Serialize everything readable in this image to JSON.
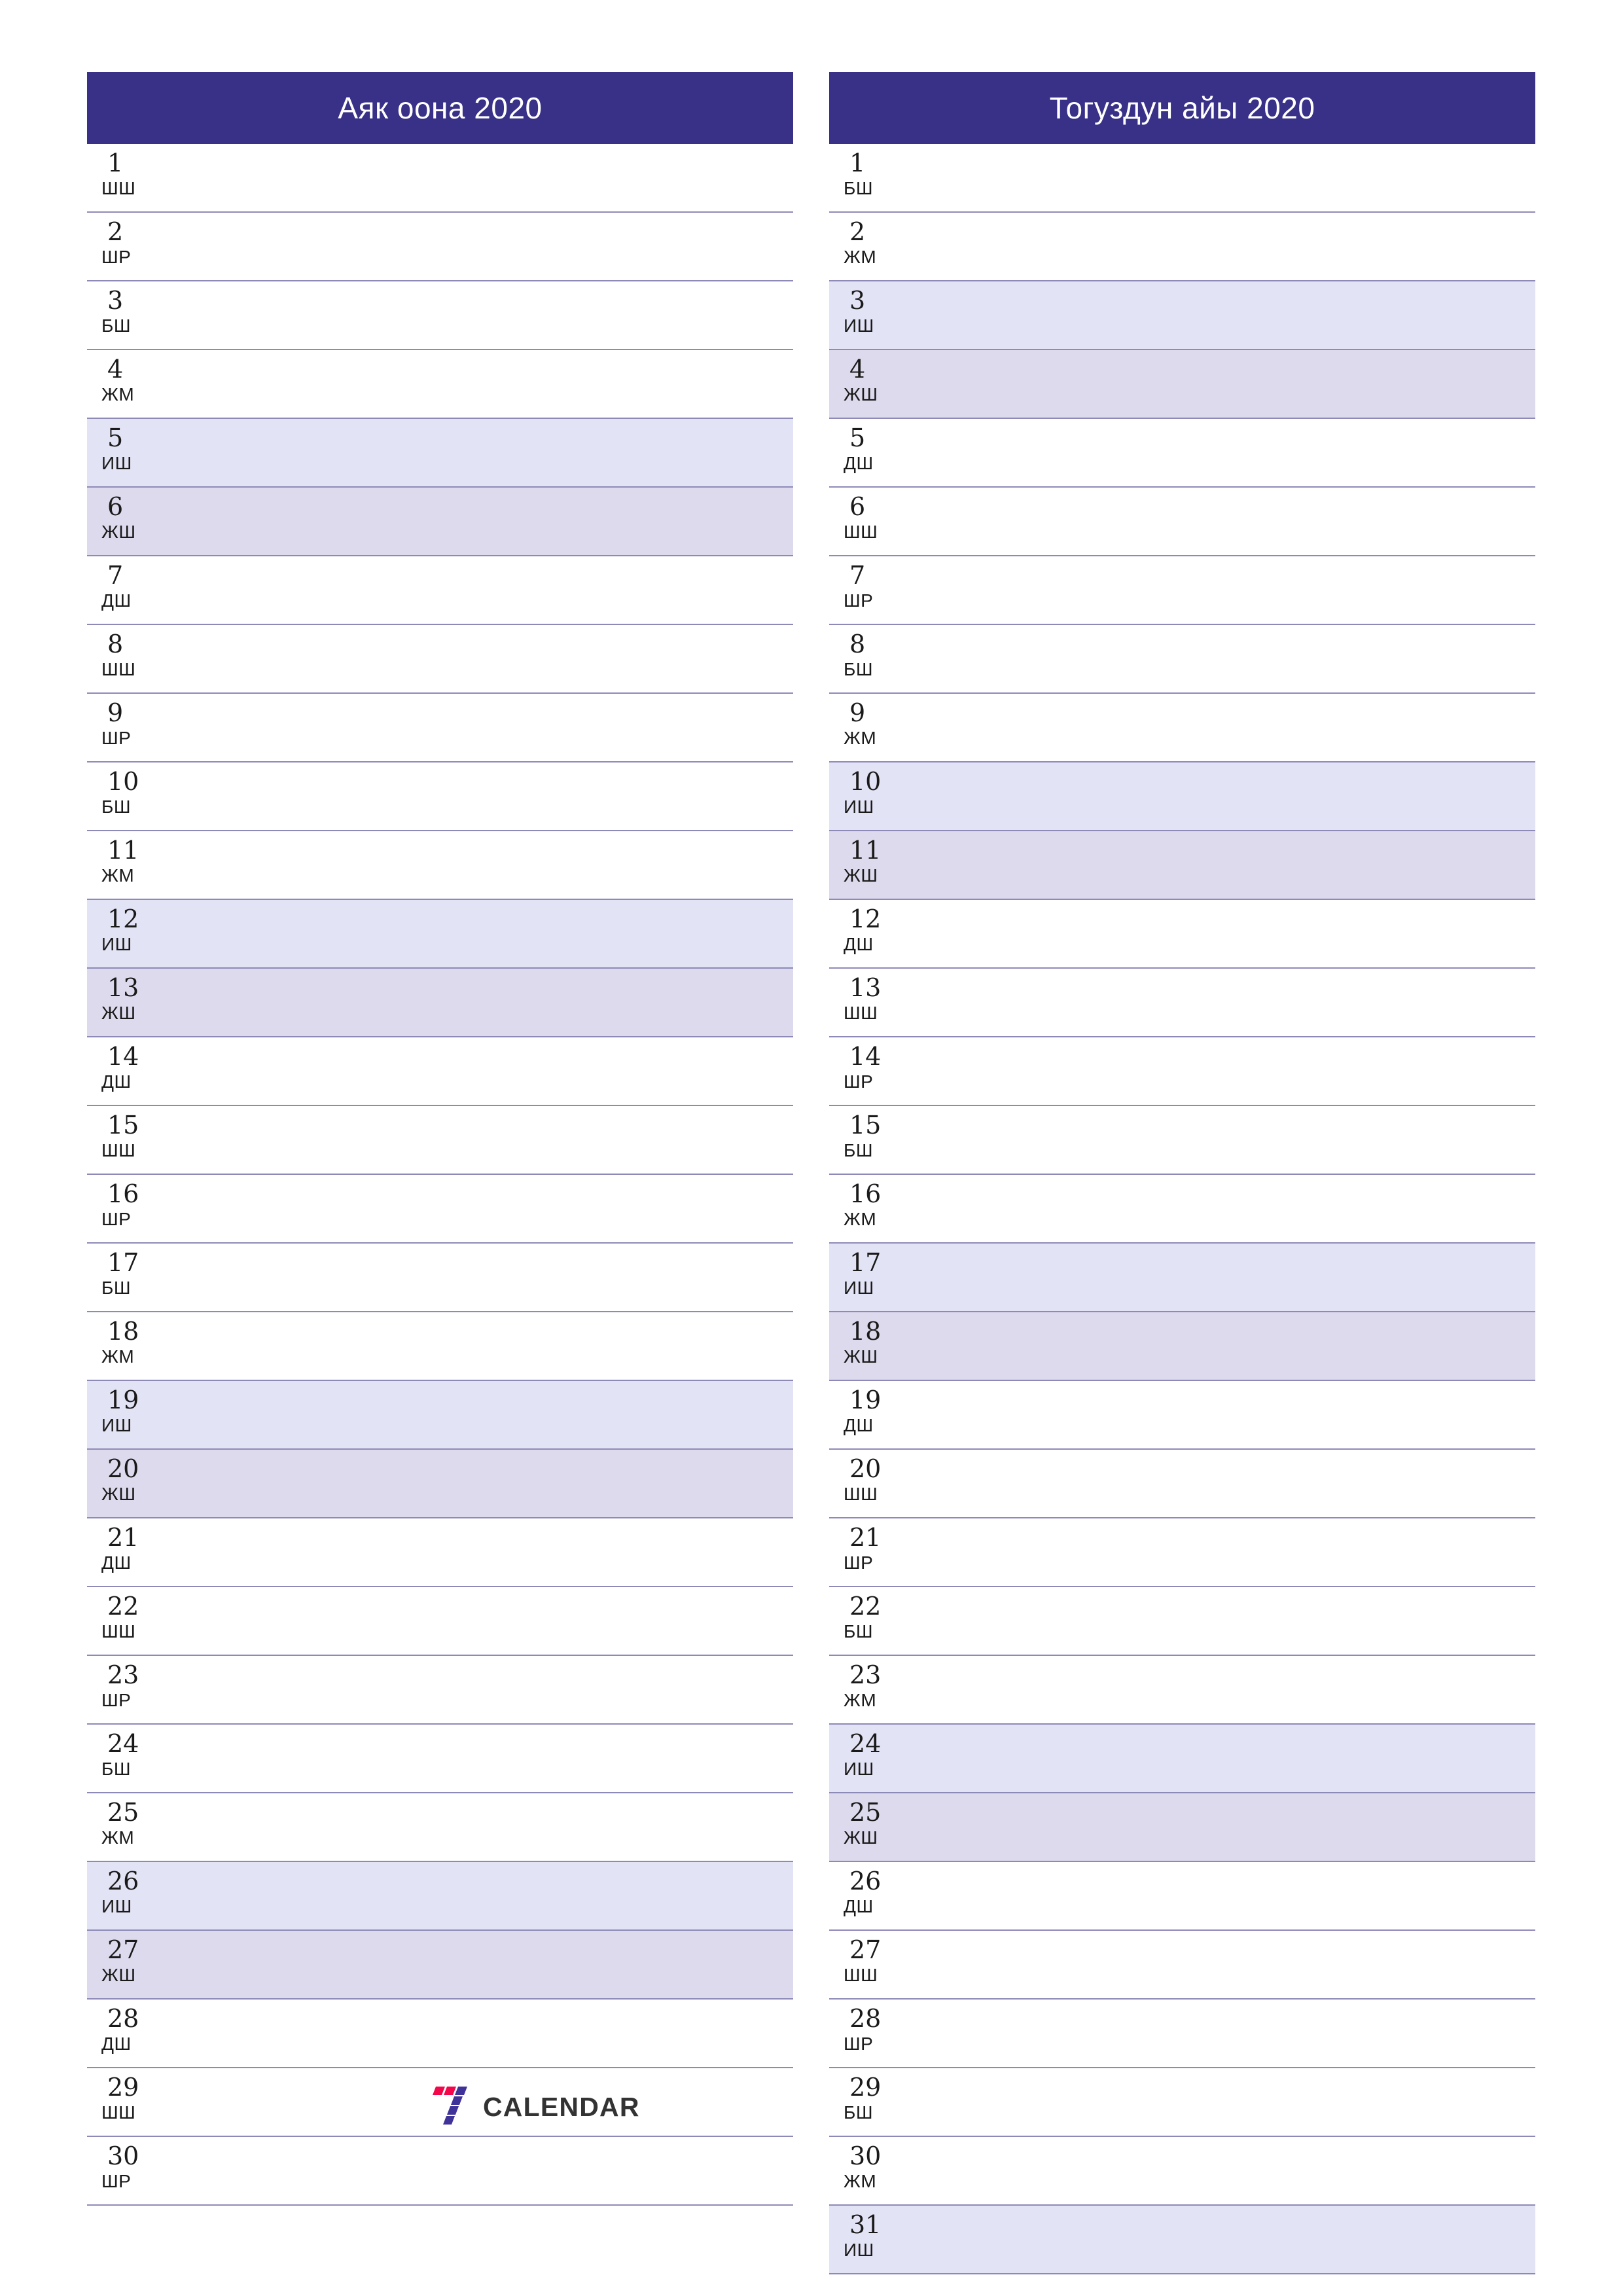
{
  "page": {
    "background_color": "#ffffff",
    "accent_color": "#383187",
    "grid_line_color": "#8e8ab8",
    "saturday_color": "#e3e3f6",
    "sunday_color": "#dddaed"
  },
  "brand": {
    "name": "CALENDAR",
    "mark_icon": "seven-logo-icon",
    "mark_colors": {
      "red": "#f4064a",
      "purple": "#3f3399"
    }
  },
  "months": [
    {
      "title": "Аяк оона 2020",
      "days": [
        {
          "num": "1",
          "abbr": "ШШ",
          "type": "weekday"
        },
        {
          "num": "2",
          "abbr": "ШР",
          "type": "weekday"
        },
        {
          "num": "3",
          "abbr": "БШ",
          "type": "weekday"
        },
        {
          "num": "4",
          "abbr": "ЖМ",
          "type": "weekday"
        },
        {
          "num": "5",
          "abbr": "ИШ",
          "type": "saturday"
        },
        {
          "num": "6",
          "abbr": "ЖШ",
          "type": "sunday"
        },
        {
          "num": "7",
          "abbr": "ДШ",
          "type": "weekday"
        },
        {
          "num": "8",
          "abbr": "ШШ",
          "type": "weekday"
        },
        {
          "num": "9",
          "abbr": "ШР",
          "type": "weekday"
        },
        {
          "num": "10",
          "abbr": "БШ",
          "type": "weekday"
        },
        {
          "num": "11",
          "abbr": "ЖМ",
          "type": "weekday"
        },
        {
          "num": "12",
          "abbr": "ИШ",
          "type": "saturday"
        },
        {
          "num": "13",
          "abbr": "ЖШ",
          "type": "sunday"
        },
        {
          "num": "14",
          "abbr": "ДШ",
          "type": "weekday"
        },
        {
          "num": "15",
          "abbr": "ШШ",
          "type": "weekday"
        },
        {
          "num": "16",
          "abbr": "ШР",
          "type": "weekday"
        },
        {
          "num": "17",
          "abbr": "БШ",
          "type": "weekday"
        },
        {
          "num": "18",
          "abbr": "ЖМ",
          "type": "weekday"
        },
        {
          "num": "19",
          "abbr": "ИШ",
          "type": "saturday"
        },
        {
          "num": "20",
          "abbr": "ЖШ",
          "type": "sunday"
        },
        {
          "num": "21",
          "abbr": "ДШ",
          "type": "weekday"
        },
        {
          "num": "22",
          "abbr": "ШШ",
          "type": "weekday"
        },
        {
          "num": "23",
          "abbr": "ШР",
          "type": "weekday"
        },
        {
          "num": "24",
          "abbr": "БШ",
          "type": "weekday"
        },
        {
          "num": "25",
          "abbr": "ЖМ",
          "type": "weekday"
        },
        {
          "num": "26",
          "abbr": "ИШ",
          "type": "saturday"
        },
        {
          "num": "27",
          "abbr": "ЖШ",
          "type": "sunday"
        },
        {
          "num": "28",
          "abbr": "ДШ",
          "type": "weekday"
        },
        {
          "num": "29",
          "abbr": "ШШ",
          "type": "weekday"
        },
        {
          "num": "30",
          "abbr": "ШР",
          "type": "weekday"
        }
      ]
    },
    {
      "title": "Тогуздун айы 2020",
      "days": [
        {
          "num": "1",
          "abbr": "БШ",
          "type": "weekday"
        },
        {
          "num": "2",
          "abbr": "ЖМ",
          "type": "weekday"
        },
        {
          "num": "3",
          "abbr": "ИШ",
          "type": "saturday"
        },
        {
          "num": "4",
          "abbr": "ЖШ",
          "type": "sunday"
        },
        {
          "num": "5",
          "abbr": "ДШ",
          "type": "weekday"
        },
        {
          "num": "6",
          "abbr": "ШШ",
          "type": "weekday"
        },
        {
          "num": "7",
          "abbr": "ШР",
          "type": "weekday"
        },
        {
          "num": "8",
          "abbr": "БШ",
          "type": "weekday"
        },
        {
          "num": "9",
          "abbr": "ЖМ",
          "type": "weekday"
        },
        {
          "num": "10",
          "abbr": "ИШ",
          "type": "saturday"
        },
        {
          "num": "11",
          "abbr": "ЖШ",
          "type": "sunday"
        },
        {
          "num": "12",
          "abbr": "ДШ",
          "type": "weekday"
        },
        {
          "num": "13",
          "abbr": "ШШ",
          "type": "weekday"
        },
        {
          "num": "14",
          "abbr": "ШР",
          "type": "weekday"
        },
        {
          "num": "15",
          "abbr": "БШ",
          "type": "weekday"
        },
        {
          "num": "16",
          "abbr": "ЖМ",
          "type": "weekday"
        },
        {
          "num": "17",
          "abbr": "ИШ",
          "type": "saturday"
        },
        {
          "num": "18",
          "abbr": "ЖШ",
          "type": "sunday"
        },
        {
          "num": "19",
          "abbr": "ДШ",
          "type": "weekday"
        },
        {
          "num": "20",
          "abbr": "ШШ",
          "type": "weekday"
        },
        {
          "num": "21",
          "abbr": "ШР",
          "type": "weekday"
        },
        {
          "num": "22",
          "abbr": "БШ",
          "type": "weekday"
        },
        {
          "num": "23",
          "abbr": "ЖМ",
          "type": "weekday"
        },
        {
          "num": "24",
          "abbr": "ИШ",
          "type": "saturday"
        },
        {
          "num": "25",
          "abbr": "ЖШ",
          "type": "sunday"
        },
        {
          "num": "26",
          "abbr": "ДШ",
          "type": "weekday"
        },
        {
          "num": "27",
          "abbr": "ШШ",
          "type": "weekday"
        },
        {
          "num": "28",
          "abbr": "ШР",
          "type": "weekday"
        },
        {
          "num": "29",
          "abbr": "БШ",
          "type": "weekday"
        },
        {
          "num": "30",
          "abbr": "ЖМ",
          "type": "weekday"
        },
        {
          "num": "31",
          "abbr": "ИШ",
          "type": "saturday"
        }
      ]
    }
  ]
}
